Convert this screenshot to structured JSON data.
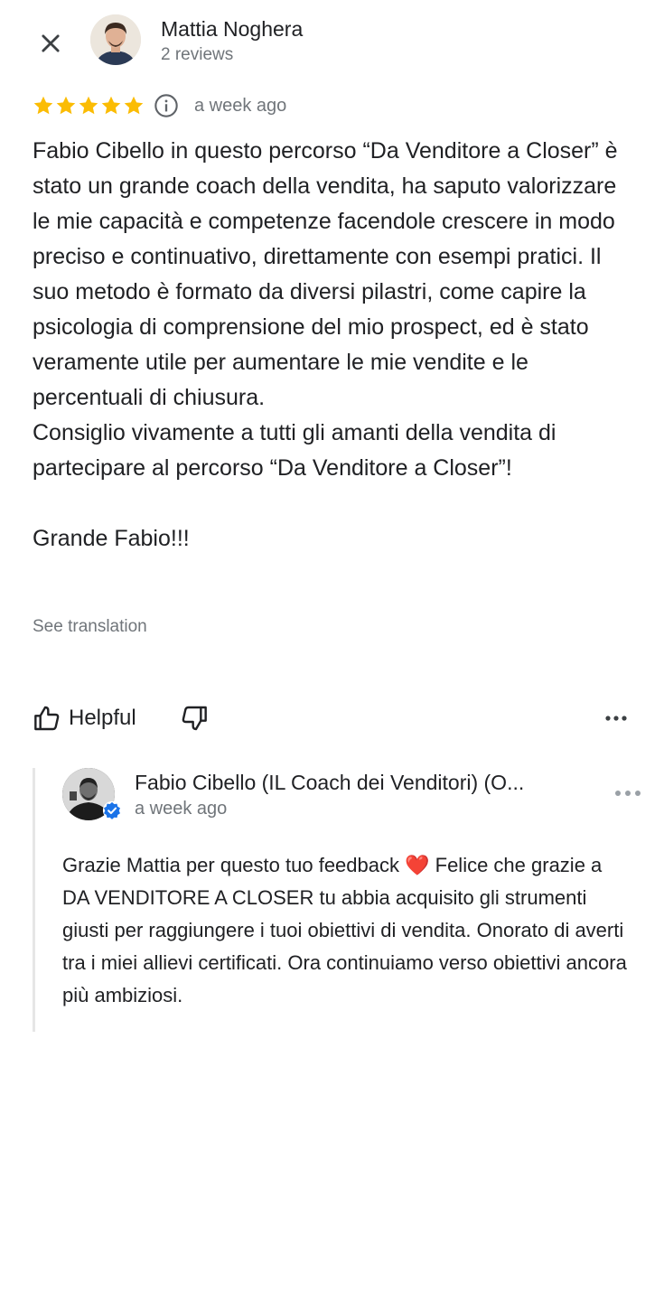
{
  "review": {
    "reviewer_name": "Mattia Noghera",
    "reviewer_reviews": "2 reviews",
    "rating": 5,
    "max_rating": 5,
    "date": "a week ago",
    "text": "Fabio Cibello in questo percorso “Da Venditore a Closer” è stato un grande coach della vendita, ha saputo valorizzare le mie capacità e competenze facendole crescere in modo preciso e continuativo, direttamente con esempi pratici. Il suo metodo è formato da diversi pilastri, come capire la psicologia di comprensione del mio prospect, ed è stato veramente utile per aumentare le mie vendite e le percentuali di chiusura.\nConsiglio vivamente a tutti gli amanti della vendita di partecipare al percorso “Da Venditore a Closer”!\n\nGrande Fabio!!!",
    "see_translation": "See translation"
  },
  "actions": {
    "helpful_label": "Helpful"
  },
  "owner_reply": {
    "name": "Fabio Cibello (IL Coach dei Venditori) (O...",
    "date": "a week ago",
    "text_before_heart": "Grazie Mattia per questo tuo feedback ",
    "heart": "❤️",
    "text_after_heart": " Felice che grazie a DA VENDITORE A CLOSER tu abbia acquisito gli strumenti giusti per raggiungere i tuoi obiettivi di vendita. Onorato di averti tra i miei allievi certificati. Ora continuiamo verso obiettivi ancora più ambiziosi."
  },
  "colors": {
    "star": "#fbbc04",
    "secondary_text": "#70757a",
    "verified_badge": "#1a73e8",
    "divider": "#e6e6e6"
  },
  "icons": [
    "close-icon",
    "star-icon",
    "info-icon",
    "thumb-up-icon",
    "thumb-down-icon",
    "more-horiz-icon",
    "verified-icon"
  ]
}
